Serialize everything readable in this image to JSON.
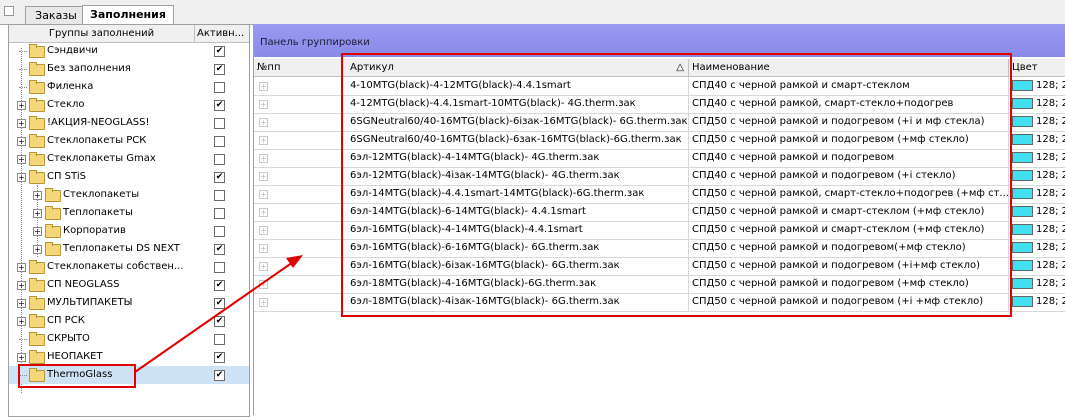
{
  "tabs": [
    {
      "label": "Заказы"
    },
    {
      "label": "Заполнения"
    }
  ],
  "left_panel": {
    "col_groups": "Группы заполнений",
    "col_active": "Активн...",
    "items": [
      {
        "label": "Сэндвичи",
        "checked": true
      },
      {
        "label": "Без заполнения",
        "checked": true
      },
      {
        "label": "Филенка",
        "checked": false
      },
      {
        "label": "Стекло",
        "checked": true
      },
      {
        "label": "!АКЦИЯ-NEOGLASS!",
        "checked": false
      },
      {
        "label": "Стеклопакеты РСК",
        "checked": false
      },
      {
        "label": "Стеклопакеты Gmax",
        "checked": false
      },
      {
        "label": "СП  STiS",
        "checked": true
      },
      {
        "label": "Стеклопакеты",
        "checked": false
      },
      {
        "label": "Теплопакеты",
        "checked": false
      },
      {
        "label": "Корпоратив",
        "checked": false
      },
      {
        "label": "Теплопакеты DS NEXT",
        "checked": true
      },
      {
        "label": "Стеклопакеты собствен...",
        "checked": false
      },
      {
        "label": "СП  NEOGLASS",
        "checked": true
      },
      {
        "label": "МУЛЬТИПАКЕТЫ",
        "checked": true
      },
      {
        "label": "СП РСК",
        "checked": true
      },
      {
        "label": "СКРЫТО",
        "checked": false
      },
      {
        "label": "НЕОПАКЕТ",
        "checked": true
      },
      {
        "label": "ThermoGlass",
        "checked": true
      }
    ]
  },
  "right_panel": {
    "group_panel_label": "Панель группировки",
    "columns": {
      "num": "№пп",
      "article": "Артикул",
      "name": "Наименование",
      "color": "Цвет"
    },
    "rows": [
      {
        "article": "4-10MTG(black)-4-12MTG(black)-4.4.1smart",
        "name": "СПД40 с черной рамкой и смарт-стеклом",
        "color": "128; 2"
      },
      {
        "article": "4-12MTG(black)-4.4.1smart-10MTG(black)- 4G.therm.зак",
        "name": "СПД40 с черной рамкой, смарт-стекло+подогрев",
        "color": "128; 2"
      },
      {
        "article": "6SGNeutral60/40-16MTG(black)-6ізак-16MTG(black)- 6G.therm.зак",
        "name": "СПД50 с черной рамкой и подогревом (+і и мф стекла)",
        "color": "128; 2"
      },
      {
        "article": "6SGNeutral60/40-16MTG(black)-6зак-16MTG(black)-6G.therm.зак",
        "name": "СПД50 с черной рамкой и подогревом (+мф стекло)",
        "color": "128; 2"
      },
      {
        "article": "6эл-12MTG(black)-4-14MTG(black)- 4G.therm.зак",
        "name": "СПД40 с черной рамкой и подогревом",
        "color": "128; 2"
      },
      {
        "article": "6эл-12MTG(black)-4ізак-14MTG(black)- 4G.therm.зак",
        "name": "СПД40 с черной рамкой и подогревом (+і стекло)",
        "color": "128; 2"
      },
      {
        "article": "6эл-14MTG(black)-4.4.1smart-14MTG(black)-6G.therm.зак",
        "name": "СПД50 с черной рамкой, смарт-стекло+подогрев (+мф ст...",
        "color": "128; 2"
      },
      {
        "article": "6эл-14MTG(black)-6-14MTG(black)- 4.4.1smart",
        "name": "СПД50 с черной рамкой и смарт-стеклом (+мф стекло)",
        "color": "128; 2"
      },
      {
        "article": "6эл-16MTG(black)-4-14MTG(black)-4.4.1smart",
        "name": "СПД50 с черной рамкой и смарт-стеклом (+мф стекло)",
        "color": "128; 2"
      },
      {
        "article": "6эл-16MTG(black)-6-16MTG(black)- 6G.therm.зак",
        "name": "СПД50 с черной рамкой и подогревом(+мф стекло)",
        "color": "128; 2"
      },
      {
        "article": "6эл-16MTG(black)-6ізак-16MTG(black)- 6G.therm.зак",
        "name": "СПД50 с черной рамкой и подогревом (+і+мф стекло)",
        "color": "128; 2"
      },
      {
        "article": "6эл-18MTG(black)-4-16MTG(black)-6G.therm.зак",
        "name": "СПД50 с черной рамкой и подогревом (+мф стекло)",
        "color": "128; 2"
      },
      {
        "article": "6эл-18MTG(black)-4ізак-16MTG(black)- 6G.therm.зак",
        "name": "СПД50 с черной рамкой и подогревом (+і +мф стекло)",
        "color": "128; 2"
      }
    ]
  },
  "colors": {
    "swatch": "#40e0f0",
    "highlight": "#e00000",
    "group_panel": "#8a8ae8"
  }
}
